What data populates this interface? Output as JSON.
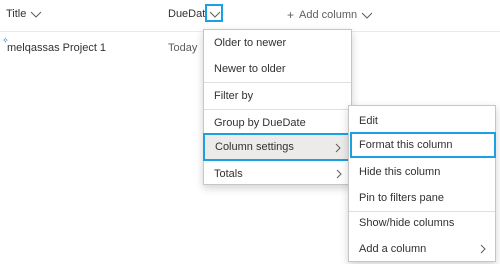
{
  "list_header": {
    "title_label": "Title",
    "duedate_label": "DueDate",
    "add_column_label": "Add column",
    "add_icon": "plus-icon",
    "chevron_icon": "chevron-down-icon"
  },
  "rows": [
    {
      "title": "melqassas Project 1",
      "due": "Today",
      "new_indicator": "✧"
    }
  ],
  "column_menu": {
    "items": [
      {
        "label": "Older to newer"
      },
      {
        "label": "Newer to older"
      },
      {
        "label": "Filter by"
      },
      {
        "label": "Group by DueDate"
      },
      {
        "label": "Column settings"
      },
      {
        "label": "Totals"
      }
    ]
  },
  "column_settings_menu": {
    "items": [
      {
        "label": "Edit"
      },
      {
        "label": "Format this column"
      },
      {
        "label": "Hide this column"
      },
      {
        "label": "Pin to filters pane"
      },
      {
        "label": "Show/hide columns"
      },
      {
        "label": "Add a column"
      }
    ]
  },
  "colors": {
    "highlight_border": "#1ba1e2",
    "hover_bg": "#edebe9"
  }
}
